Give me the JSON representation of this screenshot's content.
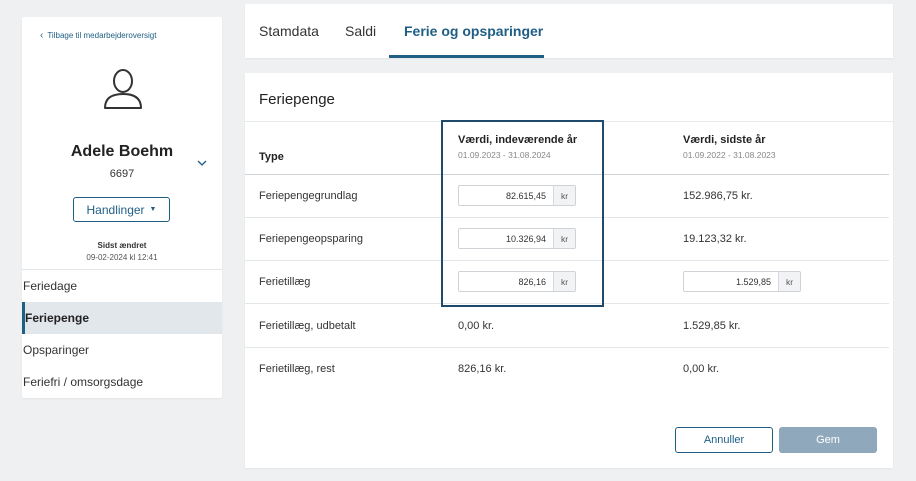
{
  "sidebar": {
    "back_label": "Tilbage til medarbejderoversigt",
    "employee_name": "Adele Boehm",
    "employee_number": "6697",
    "actions_label": "Handlinger",
    "changed_label": "Sidst ændret",
    "changed_date": "09-02-2024 kl 12:41",
    "items": [
      {
        "label": "Feriedage"
      },
      {
        "label": "Feriepenge"
      },
      {
        "label": "Opsparinger"
      },
      {
        "label": "Feriefri / omsorgsdage"
      }
    ],
    "active_item": "Feriepenge"
  },
  "tabs": [
    {
      "label": "Stamdata"
    },
    {
      "label": "Saldi"
    },
    {
      "label": "Ferie og opsparinger"
    }
  ],
  "active_tab": "Ferie og opsparinger",
  "card": {
    "title": "Feriepenge",
    "columns": {
      "type": "Type",
      "current": {
        "label": "Værdi, indeværende år",
        "period": "01.09.2023 - 31.08.2024"
      },
      "previous": {
        "label": "Værdi, sidste år",
        "period": "01.09.2022 - 31.08.2023"
      }
    },
    "rows": [
      {
        "label": "Feriepengegrundlag",
        "current": "82.615,45",
        "current_unit": "kr",
        "previous": "152.986,75 kr."
      },
      {
        "label": "Feriepengeopsparing",
        "current": "10.326,94",
        "current_unit": "kr",
        "previous": "19.123,32 kr."
      },
      {
        "label": "Ferietillæg",
        "current": "826,16",
        "current_unit": "kr",
        "previous": "1.529,85",
        "previous_unit": "kr"
      },
      {
        "label": "Ferietillæg, udbetalt",
        "current": "0,00 kr.",
        "previous": "1.529,85 kr."
      },
      {
        "label": "Ferietillæg, rest",
        "current": "826,16 kr.",
        "previous": "0,00 kr."
      }
    ],
    "cancel_label": "Annuller",
    "save_label": "Gem"
  },
  "colors": {
    "accent": "#1f5e85",
    "highlight_border": "#1f4a6b",
    "save_button": "#8fa8bc",
    "background": "#eef0f2"
  }
}
